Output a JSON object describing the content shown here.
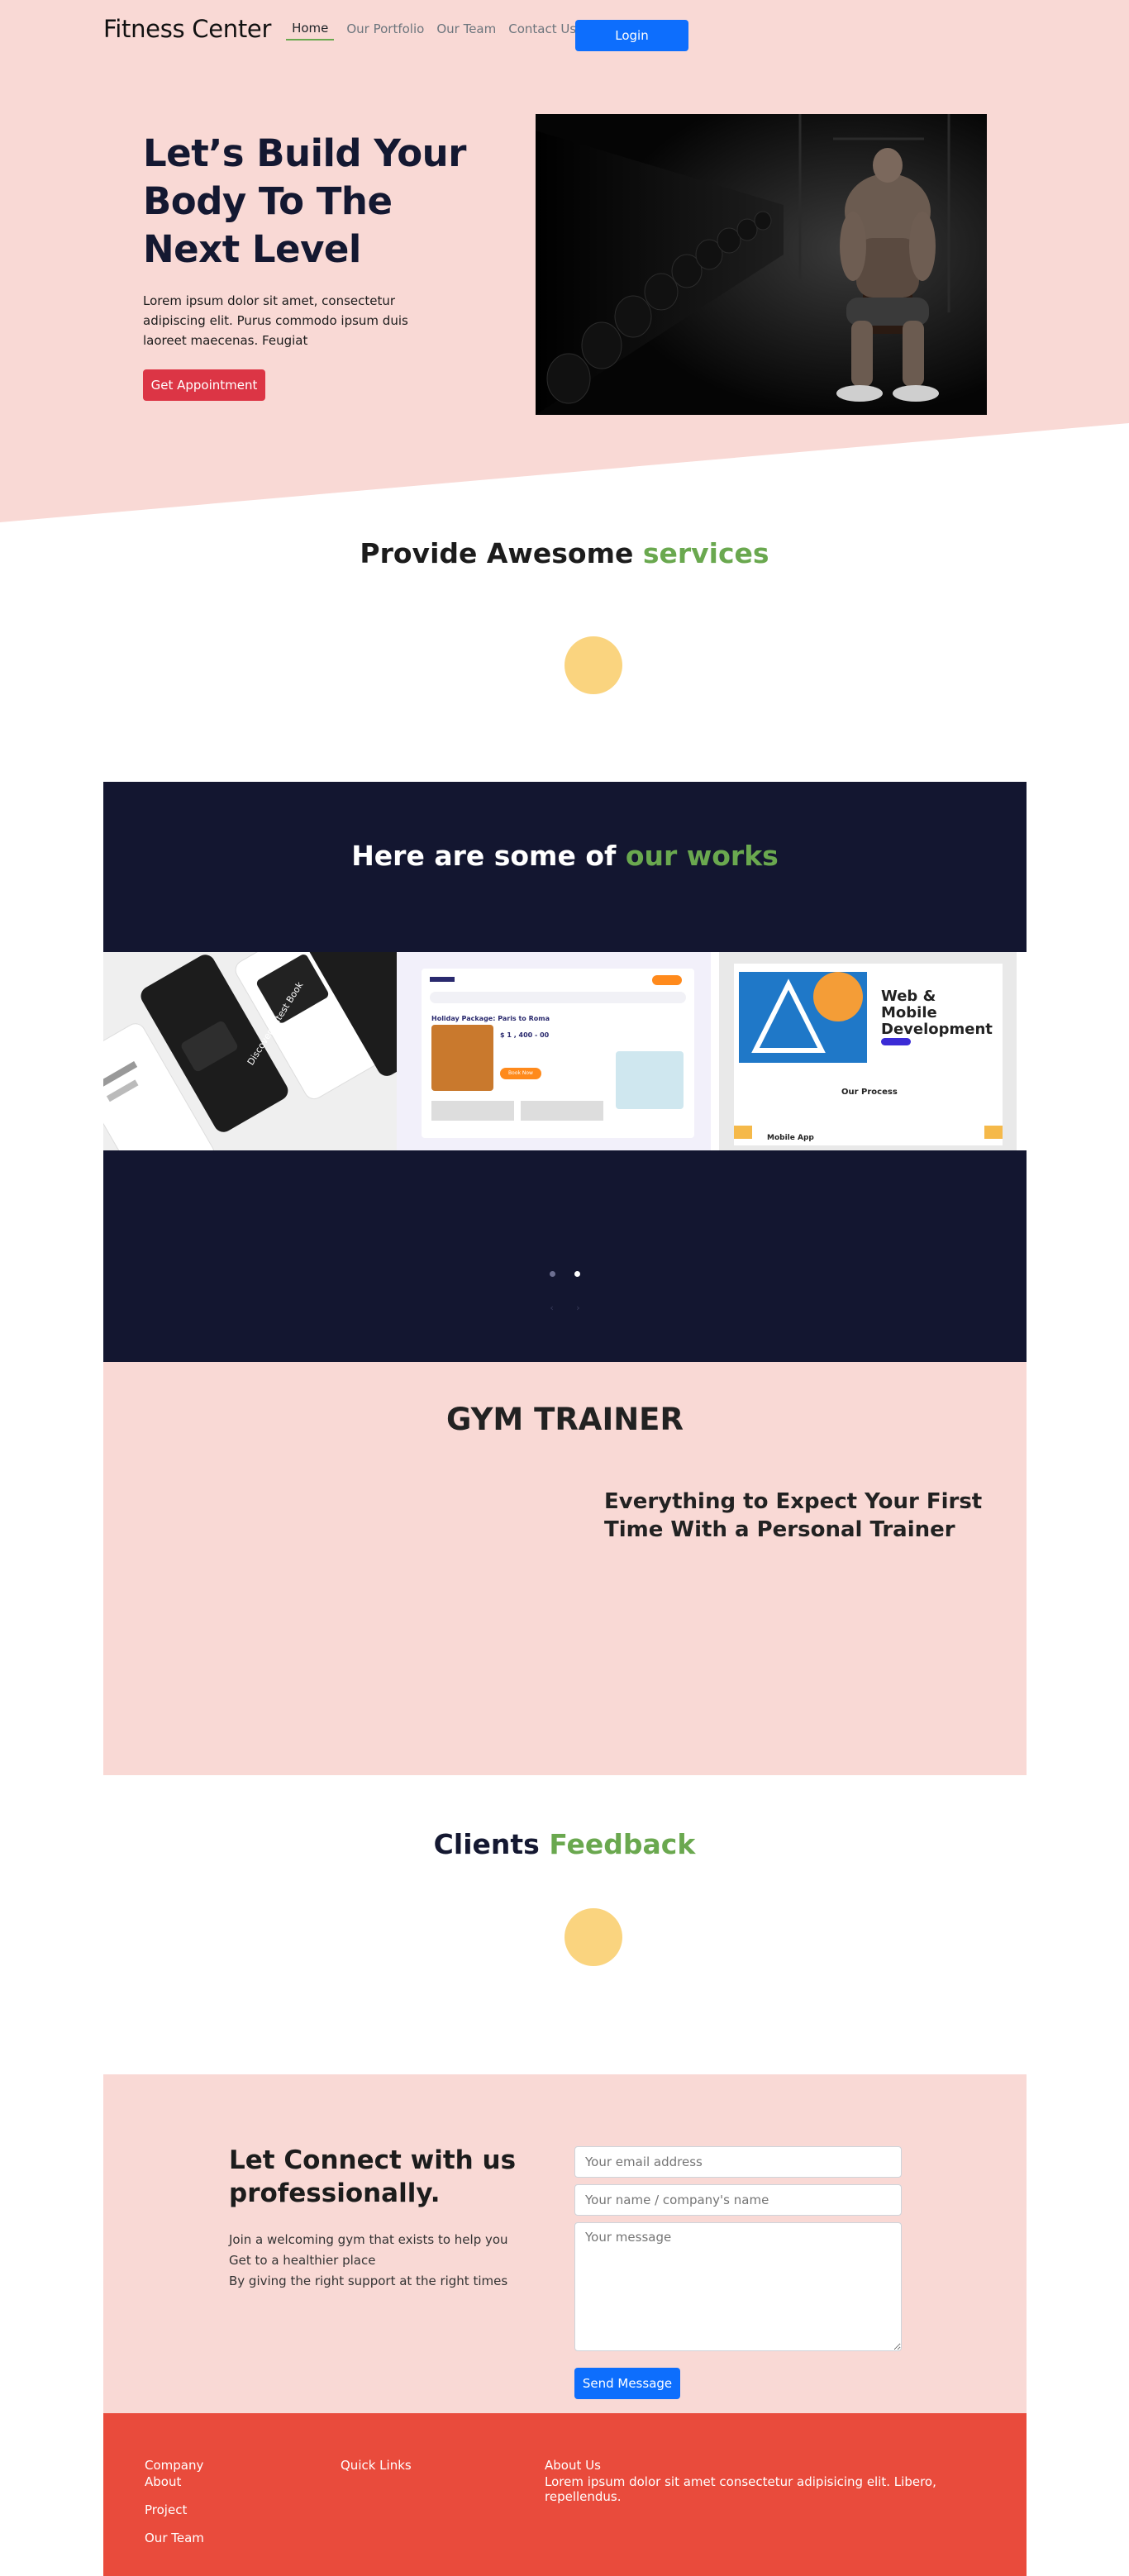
{
  "nav": {
    "brand": "Fitness Center",
    "links": [
      "Home",
      "Our Portfolio",
      "Our Team",
      "Contact Us"
    ],
    "login": "Login"
  },
  "hero": {
    "title": "Let’s Build Your Body To The Next Level",
    "text": "Lorem ipsum dolor sit amet, consectetur adipiscing elit. Purus commodo ipsum duis laoreet maecenas. Feugiat",
    "button": "Get Appointment"
  },
  "services": {
    "title_a": "Provide Awesome",
    "title_b": "services"
  },
  "works": {
    "title_a": "Here are some of",
    "title_b": "our works",
    "cards": [
      {
        "heading": "Discover Latest Book"
      },
      {
        "heading": "Holiday Package: Paris to Roma",
        "price": "$ 1 , 400 - 00",
        "button": "Book Now"
      },
      {
        "heading": "Web & Mobile Development",
        "sub": "Our Process",
        "foot": "Mobile App"
      }
    ],
    "arrows": [
      "‹",
      "›"
    ]
  },
  "trainer": {
    "title": "GYM TRAINER",
    "subtitle": "Everything to Expect Your First Time With a Personal Trainer"
  },
  "feedback": {
    "title_a": "Clients",
    "title_b": "Feedback"
  },
  "contact": {
    "title": "Let Connect with us professionally.",
    "lines": [
      "Join a welcoming gym that exists to help you",
      "Get to a healthier place",
      "By giving the right support at the right times"
    ],
    "email_placeholder": "Your email address",
    "name_placeholder": "Your name / company's name",
    "message_placeholder": "Your message",
    "send": "Send Message"
  },
  "footer": {
    "company_heading": "Company",
    "company_links": [
      "About",
      "Project",
      "Our Team"
    ],
    "quick_heading": "Quick Links",
    "about_heading": "About Us",
    "about_text": "Lorem ipsum dolor sit amet consectetur adipisicing elit. Libero, repellendus."
  },
  "colors": {
    "pink": "#f9d9d5",
    "navy": "#131630",
    "accent_green": "#6aa84f",
    "primary_blue": "#0d6efd",
    "red": "#dc3545",
    "footer_red": "#e94b3c",
    "yellow": "#fad47f"
  }
}
